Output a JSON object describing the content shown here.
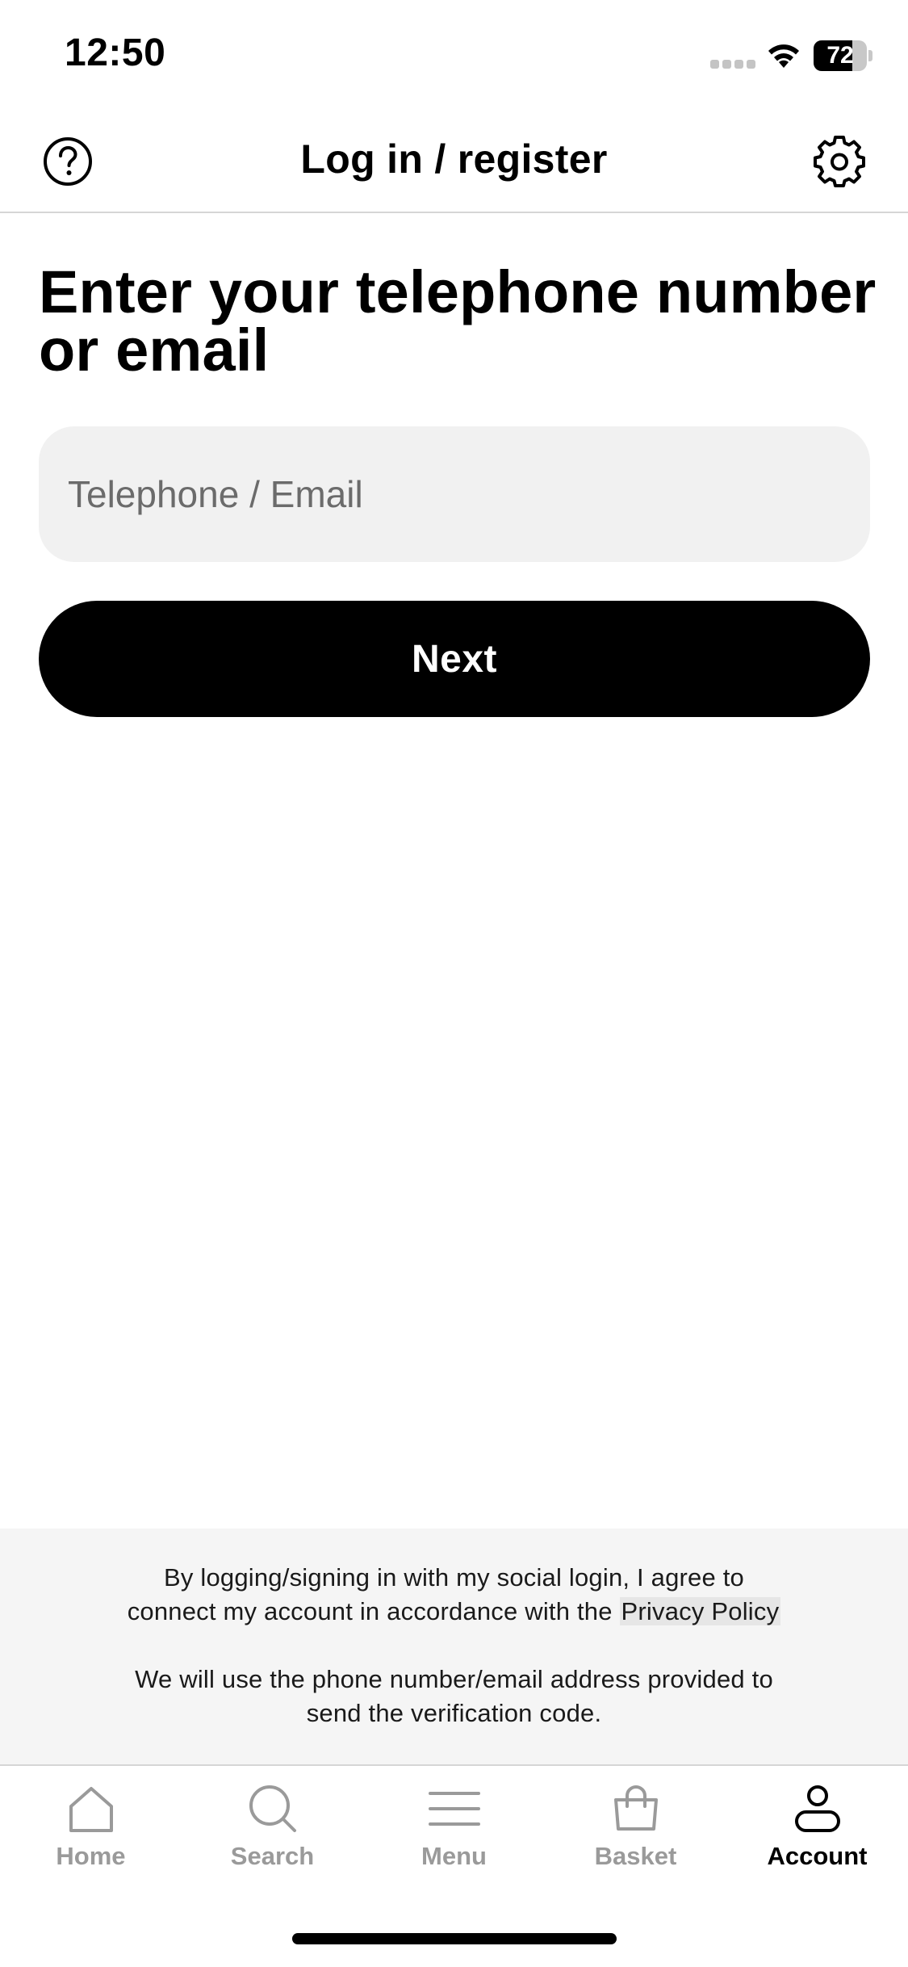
{
  "status_bar": {
    "time": "12:50",
    "battery_level": "72",
    "battery_fraction": 0.72,
    "signal_icon": "cellular-dots-icon",
    "wifi_icon": "wifi-icon"
  },
  "header": {
    "title": "Log in / register",
    "help_icon": "question-circle-icon",
    "settings_icon": "gear-icon"
  },
  "main": {
    "heading": "Enter your telephone number or email",
    "input_placeholder": "Telephone / Email",
    "input_value": "",
    "next_label": "Next"
  },
  "legal": {
    "line1": "By logging/signing in with my social login, I agree to",
    "line2_prefix": "connect my account in accordance with the",
    "privacy_link": "Privacy Policy",
    "line3": "We will use the phone number/email address provided to",
    "line4": "send the verification code."
  },
  "tabs": [
    {
      "label": "Home",
      "icon": "home-icon",
      "active": false
    },
    {
      "label": "Search",
      "icon": "search-icon",
      "active": false
    },
    {
      "label": "Menu",
      "icon": "menu-icon",
      "active": false
    },
    {
      "label": "Basket",
      "icon": "basket-icon",
      "active": false
    },
    {
      "label": "Account",
      "icon": "account-icon",
      "active": true
    }
  ],
  "colors": {
    "primary": "#000000",
    "background": "#ffffff",
    "input_background": "#f1f1f1",
    "legal_background": "#f5f5f5",
    "inactive_tab": "#9a9a9a"
  }
}
